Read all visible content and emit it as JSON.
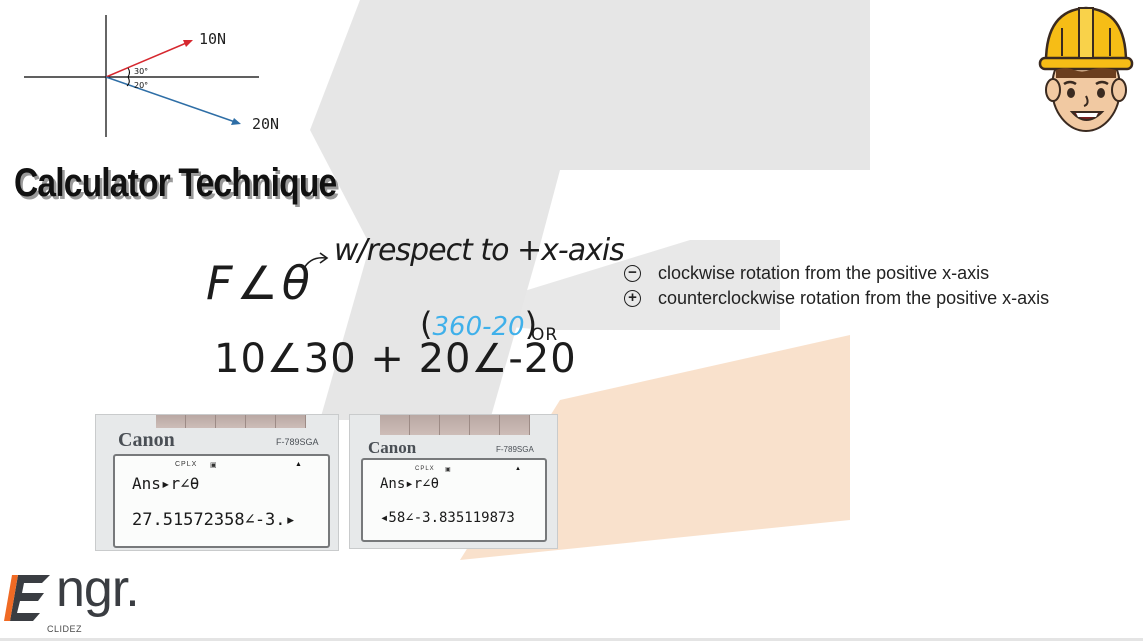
{
  "diagram": {
    "force1_label": "10N",
    "force2_label": "20N",
    "angle1_label": "30°",
    "angle2_label": "20°"
  },
  "title": "Calculator Technique",
  "handwriting": {
    "f_angle_theta": "F∠θ",
    "respect_note": "w/respect to +x-axis",
    "blue_expr": "360-20",
    "or_label": "OR",
    "expression": "10∠30 + 20∠-20"
  },
  "legend": {
    "negative_sign": "−",
    "negative_text": "clockwise rotation from the positive x-axis",
    "positive_sign": "+",
    "positive_text": "counterclockwise rotation from the positive x-axis"
  },
  "calculator_left": {
    "brand": "Canon",
    "model": "F-789SGA",
    "status": "CPLX",
    "input": "Ans▸r∠θ",
    "result": "27.51572358∠-3.▸"
  },
  "calculator_right": {
    "brand": "Canon",
    "model": "F-789SGA",
    "status": "CPLX",
    "input": "Ans▸r∠θ",
    "result": "◂58∠-3.835119873"
  },
  "logo": {
    "text": "ngr.",
    "subtext": "CLIDEZ"
  },
  "colors": {
    "force1_arrow": "#d6282f",
    "force2_arrow": "#2e6ea6",
    "highlight_blue": "#3fb0ea",
    "watermark_gray": "#dcdcdc",
    "watermark_orange": "#f8dcc4",
    "logo_orange": "#f06a24"
  }
}
